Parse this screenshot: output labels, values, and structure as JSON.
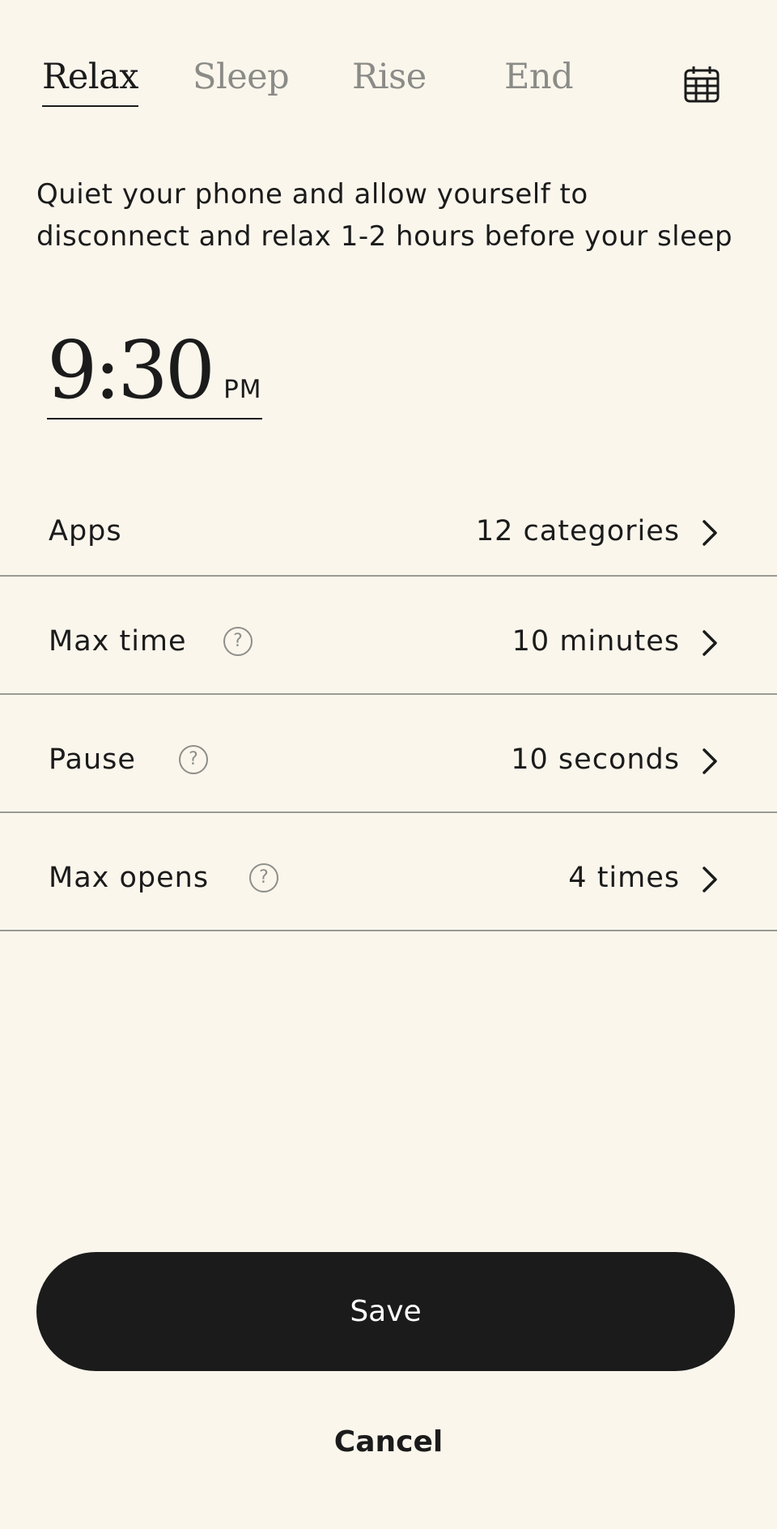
{
  "tabs": [
    {
      "label": "Relax",
      "active": true
    },
    {
      "label": "Sleep",
      "active": false
    },
    {
      "label": "Rise",
      "active": false
    },
    {
      "label": "End",
      "active": false
    }
  ],
  "calendar_icon": "calendar-icon",
  "description": "Quiet your phone and allow yourself to disconnect and relax 1-2 hours before your sleep",
  "time": {
    "value": "9:30",
    "ampm": "PM"
  },
  "settings": [
    {
      "label": "Apps",
      "value": "12 categories",
      "has_help": false
    },
    {
      "label": "Max time",
      "value": "10 minutes",
      "has_help": true
    },
    {
      "label": "Pause",
      "value": "10 seconds",
      "has_help": true
    },
    {
      "label": "Max opens",
      "value": "4 times",
      "has_help": true
    }
  ],
  "help_glyph": "?",
  "actions": {
    "save_label": "Save",
    "cancel_label": "Cancel"
  },
  "colors": {
    "background": "#faf6ec",
    "text": "#1b1b1b",
    "inactive_tab": "#8b8b87",
    "divider": "#9a9a94",
    "button_bg": "#1b1b1b",
    "button_text": "#ffffff"
  }
}
